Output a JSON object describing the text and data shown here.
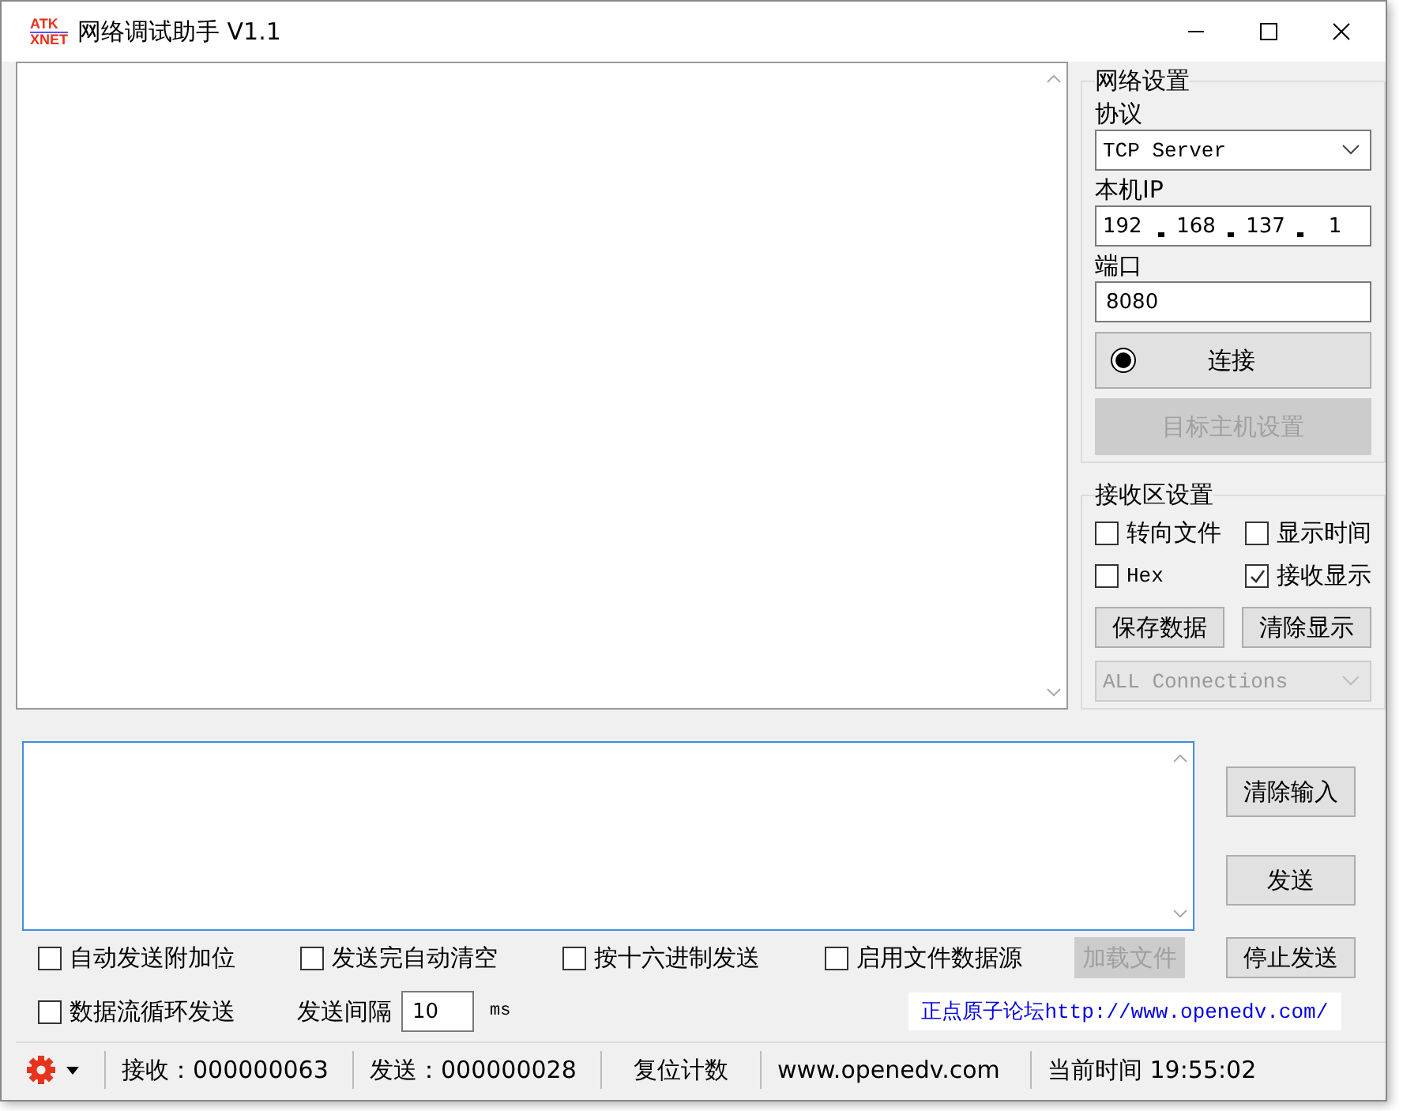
{
  "window": {
    "title": "网络调试助手 V1.1",
    "logo_top": "ATK",
    "logo_bottom": "XNET"
  },
  "network": {
    "title": "网络设置",
    "protocol_label": "协议",
    "protocol": "TCP Server",
    "ip_label": "本机IP",
    "ip": [
      "192",
      "168",
      "137",
      "1"
    ],
    "port_label": "端口",
    "port": "8080",
    "connect": {
      "label": "连接",
      "connected": true
    },
    "target": {
      "label": "目标主机设置",
      "disabled": true
    }
  },
  "receive": {
    "title": "接收区设置",
    "options": [
      {
        "label": "转向文件",
        "checked": false
      },
      {
        "label": "显示时间",
        "checked": false
      },
      {
        "label": "Hex",
        "checked": false
      },
      {
        "label": "接收显示",
        "checked": true
      }
    ],
    "buttons": [
      "保存数据",
      "清除显示"
    ],
    "connections": {
      "value": "ALL Connections",
      "disabled": true
    }
  },
  "send": {
    "buttons": [
      "清除输入",
      "发送"
    ],
    "options": [
      {
        "label": "自动发送附加位",
        "checked": false
      },
      {
        "label": "发送完自动清空",
        "checked": false
      },
      {
        "label": "按十六进制发送",
        "checked": false
      },
      {
        "label": "启用文件数据源",
        "checked": false
      }
    ],
    "load_file": {
      "label": "加载文件",
      "disabled": true
    },
    "stop": "停止发送",
    "loop": {
      "label": "数据流循环发送",
      "checked": false
    },
    "interval_label": "发送间隔",
    "interval": "10",
    "unit": "ms",
    "link": "正点原子论坛http://www.openedv.com/"
  },
  "status_bar": {
    "received": "接收：000000063",
    "sent": "发送：000000028",
    "reset": "复位计数",
    "site": "www.openedv.com",
    "time": "当前时间 19:55:02"
  }
}
